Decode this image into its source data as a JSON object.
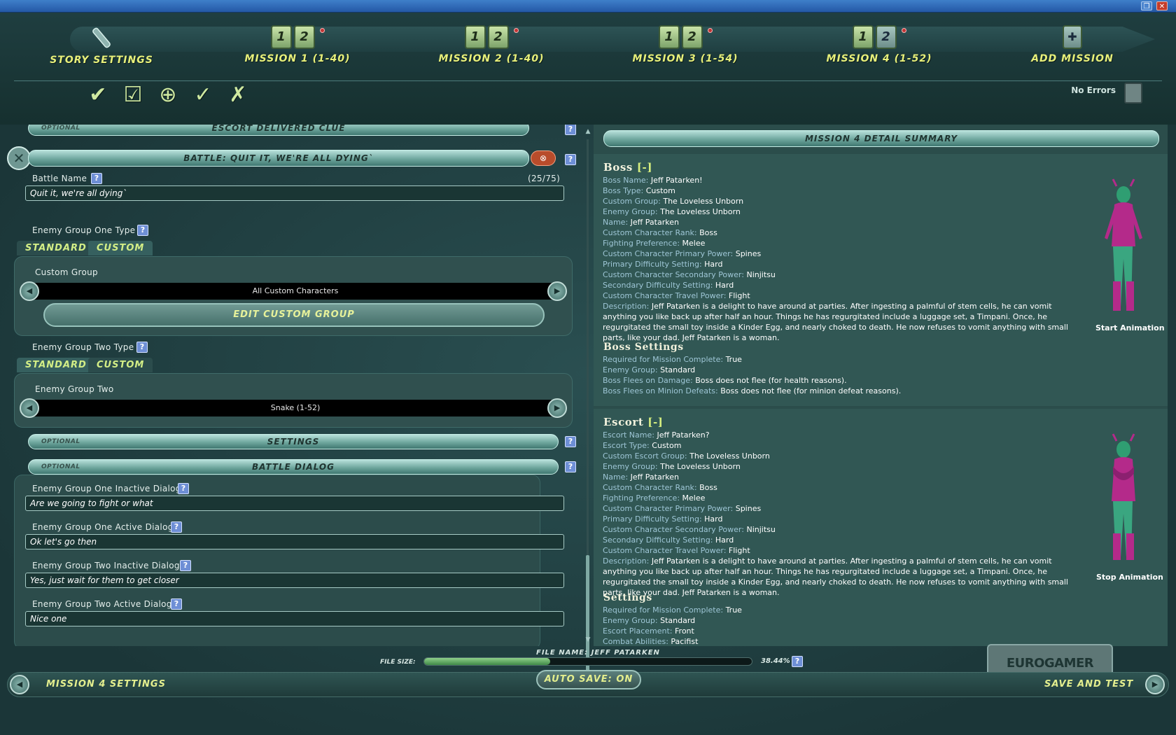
{
  "window": {
    "restore_glyph": "❐",
    "close_glyph": "✕"
  },
  "topnav": {
    "tabs": [
      {
        "label": "STORY SETTINGS"
      },
      {
        "label": "MISSION 1 (1-40)",
        "tile1": "1",
        "tile2": "2"
      },
      {
        "label": "MISSION 2 (1-40)",
        "tile1": "1",
        "tile2": "2"
      },
      {
        "label": "MISSION 3 (1-54)",
        "tile1": "1",
        "tile2": "2"
      },
      {
        "label": "MISSION 4 (1-52)",
        "tile1": "1",
        "tile2": "2"
      },
      {
        "label": "ADD MISSION"
      }
    ],
    "no_errors": "No Errors",
    "tool_icons": [
      "checkmark-icon",
      "checkbox-icon",
      "target-icon",
      "check-list-icon",
      "x-list-icon"
    ]
  },
  "left": {
    "escort_bar": {
      "optional": "OPTIONAL",
      "title": "ESCORT DELIVERED CLUE"
    },
    "battle_bar": {
      "title": "BATTLE: QUIT IT, WE'RE ALL DYING`"
    },
    "battle_name": {
      "label": "Battle Name",
      "counter": "(25/75)",
      "value": "Quit it, we're all dying`"
    },
    "group_one": {
      "label": "Enemy Group One Type",
      "tab_standard": "STANDARD",
      "tab_custom": "CUSTOM",
      "sub_label": "Custom Group",
      "value": "All Custom Characters",
      "edit_button": "EDIT CUSTOM GROUP"
    },
    "group_two": {
      "label": "Enemy Group Two Type",
      "tab_standard": "STANDARD",
      "tab_custom": "CUSTOM",
      "sub_label": "Enemy Group Two",
      "value": "Snake (1-52)"
    },
    "settings_bar": {
      "optional": "OPTIONAL",
      "title": "SETTINGS"
    },
    "dialog_bar": {
      "optional": "OPTIONAL",
      "title": "BATTLE DIALOG"
    },
    "dialogs": [
      {
        "label": "Enemy Group One Inactive Dialog",
        "value": "Are we going to fight or what"
      },
      {
        "label": "Enemy Group One Active Dialog",
        "value": "Ok let's go then"
      },
      {
        "label": "Enemy Group Two Inactive Dialog",
        "value": "Yes, just wait for them to get closer"
      },
      {
        "label": "Enemy Group Two Active Dialog",
        "value": "Nice one"
      }
    ]
  },
  "right": {
    "header": "MISSION 4 DETAIL SUMMARY",
    "boss": {
      "title": "Boss",
      "minus": "[-]",
      "rows": [
        {
          "k": "Boss Name:",
          "v": "Jeff Patarken!"
        },
        {
          "k": "Boss Type:",
          "v": "Custom"
        },
        {
          "k": "Custom Group:",
          "v": "The Loveless Unborn"
        },
        {
          "k": "Enemy Group:",
          "v": "The Loveless Unborn"
        },
        {
          "k": "Name:",
          "v": "Jeff Patarken"
        },
        {
          "k": "Custom Character Rank:",
          "v": "Boss"
        },
        {
          "k": "Fighting Preference:",
          "v": "Melee"
        },
        {
          "k": "Custom Character Primary Power:",
          "v": "Spines"
        },
        {
          "k": "Primary Difficulty Setting:",
          "v": "Hard"
        },
        {
          "k": "Custom Character Secondary Power:",
          "v": "Ninjitsu"
        },
        {
          "k": "Secondary Difficulty Setting:",
          "v": "Hard"
        },
        {
          "k": "Custom Character Travel Power:",
          "v": "Flight"
        }
      ],
      "desc_k": "Description:",
      "desc_v": "Jeff Patarken is a delight to have around at parties. After ingesting a palmful of stem cells, he can vomit anything you like back up after half an hour. Things he has regurgitated include a luggage set, a Timpani. Once, he regurgitated the small toy inside a Kinder Egg, and nearly choked to death. He now refuses to vomit anything with small parts, like your dad. Jeff Patarken is a woman.",
      "anim": "Start Animation"
    },
    "boss_settings": {
      "title": "Boss Settings",
      "rows": [
        {
          "k": "Required for Mission Complete:",
          "v": "True"
        },
        {
          "k": "Enemy Group:",
          "v": "Standard"
        },
        {
          "k": "Boss Flees on Damage:",
          "v": "Boss does not flee (for health reasons)."
        },
        {
          "k": "Boss Flees on Minion Defeats:",
          "v": "Boss does not flee (for minion defeat reasons)."
        }
      ]
    },
    "escort": {
      "title": "Escort",
      "minus": "[-]",
      "rows": [
        {
          "k": "Escort Name:",
          "v": "Jeff Patarken?"
        },
        {
          "k": "Escort Type:",
          "v": "Custom"
        },
        {
          "k": "Custom Escort Group:",
          "v": "The Loveless Unborn"
        },
        {
          "k": "Enemy Group:",
          "v": "The Loveless Unborn"
        },
        {
          "k": "Name:",
          "v": "Jeff Patarken"
        },
        {
          "k": "Custom Character Rank:",
          "v": "Boss"
        },
        {
          "k": "Fighting Preference:",
          "v": "Melee"
        },
        {
          "k": "Custom Character Primary Power:",
          "v": "Spines"
        },
        {
          "k": "Primary Difficulty Setting:",
          "v": "Hard"
        },
        {
          "k": "Custom Character Secondary Power:",
          "v": "Ninjitsu"
        },
        {
          "k": "Secondary Difficulty Setting:",
          "v": "Hard"
        },
        {
          "k": "Custom Character Travel Power:",
          "v": "Flight"
        }
      ],
      "desc_k": "Description:",
      "desc_v": "Jeff Patarken is a delight to have around at parties. After ingesting a palmful of stem cells, he can vomit anything you like back up after half an hour. Things he has regurgitated include a luggage set, a Timpani. Once, he regurgitated the small toy inside a Kinder Egg, and nearly choked to death. He now refuses to vomit anything with small parts, like your dad. Jeff Patarken is a woman.",
      "anim": "Stop Animation"
    },
    "escort_settings": {
      "title": "Settings",
      "rows": [
        {
          "k": "Required for Mission Complete:",
          "v": "True"
        },
        {
          "k": "Enemy Group:",
          "v": "Standard"
        },
        {
          "k": "Escort Placement:",
          "v": "Front"
        },
        {
          "k": "Combat Abilities:",
          "v": "Pacifist"
        }
      ]
    },
    "watermark": "EUROGAMER"
  },
  "bottom": {
    "file_name": "FILE NAME: JEFF PATARKEN",
    "file_size_label": "FILE SIZE:",
    "file_size_pct": "38.44%",
    "file_size_fraction": 0.3844,
    "left_nav": "MISSION 4 SETTINGS",
    "autosave": "AUTO SAVE: ON",
    "right_nav": "SAVE AND TEST"
  },
  "help_glyph": "?"
}
